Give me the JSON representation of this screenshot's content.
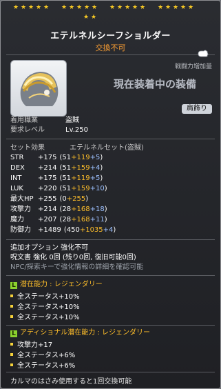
{
  "header": {
    "stars_count": 22,
    "star_color": "#f6c825",
    "title": "エテルネルシーフショルダー",
    "trade_status": "交換不可"
  },
  "compare": {
    "icon": "glove-cursor-icon",
    "label": "戦闘力増加量",
    "equipped_text": "現在装着中の装備",
    "slot_badge": "肩飾り"
  },
  "item": {
    "icon": "gold-shoulder-armor-icon"
  },
  "info": {
    "job_label": "着用職業",
    "job_value": "盗賊",
    "level_label": "要求レベル",
    "level_value": "Lv.250"
  },
  "set": {
    "label": "セット効果",
    "value": "エテルネルセット(盗賊)"
  },
  "stats": [
    {
      "name": "STR",
      "total": "+175",
      "open": "(51",
      "a": "+119",
      "b": "+5",
      "close": ")"
    },
    {
      "name": "DEX",
      "total": "+214",
      "open": "(51",
      "a": "+159",
      "b": "+4",
      "close": ")"
    },
    {
      "name": "INT",
      "total": "+175",
      "open": "(51",
      "a": "+119",
      "b": "+5",
      "close": ")"
    },
    {
      "name": "LUK",
      "total": "+220",
      "open": "(51",
      "a": "+159",
      "b": "+10",
      "close": ")"
    },
    {
      "name": "最大HP",
      "total": "+255",
      "open": "(0",
      "a": "+255",
      "b": "",
      "close": ")"
    },
    {
      "name": "攻撃力",
      "total": "+214",
      "open": "(28",
      "a": "+168",
      "b": "+18",
      "close": ")"
    },
    {
      "name": "魔力",
      "total": "+207",
      "open": "(28",
      "a": "+168",
      "b": "+11",
      "close": ")"
    },
    {
      "name": "防御力",
      "total": "+1489",
      "open": "(450",
      "a": "+1035",
      "b": "+4",
      "close": ")"
    }
  ],
  "extra": {
    "additional_option": "追加オプション 強化不可",
    "scroll": "呪文書 強化 0回 (残り0回, 復旧可能0回)",
    "hint": "NPC/探索キーで強化情報の詳細を確認可能"
  },
  "potential": {
    "badge": "L",
    "title": "潜在能力 : レジェンダリー",
    "lines": [
      "全ステータス+10%",
      "全ステータス+10%",
      "全ステータス+10%"
    ]
  },
  "additional_potential": {
    "badge": "L",
    "title": "アディショナル潜在能力 : レジェンダリー",
    "lines": [
      "攻撃力+17",
      "全ステータス+6%",
      "全ステータス+6%"
    ]
  },
  "footer": {
    "text": "カルマのはさみ使用すると1回交換可能"
  },
  "colors": {
    "accent_orange": "#f39a33",
    "green": "#7fd03a",
    "yellow": "#ffbf2a",
    "blue": "#9cc0ff",
    "legendary_green": "#8bd12e"
  }
}
